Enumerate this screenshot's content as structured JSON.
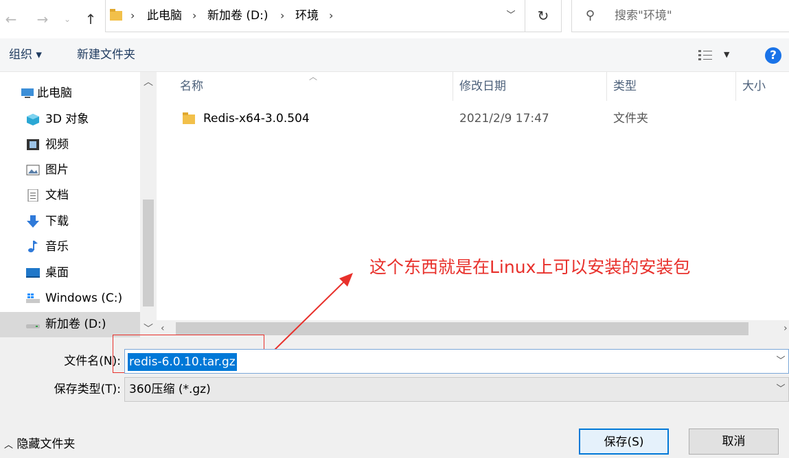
{
  "address_bar": {
    "breadcrumbs": [
      "此电脑",
      "新加卷 (D:)",
      "环境"
    ],
    "search_placeholder": "搜索\"环境\""
  },
  "toolbar": {
    "organize_label": "组织 ▾",
    "new_folder_label": "新建文件夹",
    "help_label": "?"
  },
  "nav_pane": {
    "items": [
      {
        "label": "此电脑",
        "icon": "computer-icon"
      },
      {
        "label": "3D 对象",
        "icon": "cube-3d-icon"
      },
      {
        "label": "视频",
        "icon": "video-icon"
      },
      {
        "label": "图片",
        "icon": "picture-icon"
      },
      {
        "label": "文档",
        "icon": "document-icon"
      },
      {
        "label": "下载",
        "icon": "download-icon"
      },
      {
        "label": "音乐",
        "icon": "music-icon"
      },
      {
        "label": "桌面",
        "icon": "desktop-icon"
      },
      {
        "label": "Windows (C:)",
        "icon": "windows-drive-icon"
      },
      {
        "label": "新加卷 (D:)",
        "icon": "drive-icon",
        "selected": true
      }
    ]
  },
  "file_list": {
    "columns": [
      "名称",
      "修改日期",
      "类型",
      "大小"
    ],
    "rows": [
      {
        "name": "Redis-x64-3.0.504",
        "modified": "2021/2/9 17:47",
        "type": "文件夹",
        "size": ""
      }
    ]
  },
  "annotation": {
    "text": "这个东西就是在Linux上可以安装的安装包",
    "color": "#e8302b"
  },
  "form": {
    "filename_label": "文件名(N):",
    "filename_value": "redis-6.0.10.tar.gz",
    "filetype_label": "保存类型(T):",
    "filetype_value": "360压缩 (*.gz)"
  },
  "footer": {
    "hide_folders_label": "隐藏文件夹",
    "save_label": "保存(S)",
    "cancel_label": "取消"
  },
  "colors": {
    "accent": "#0078d7",
    "folder": "#f2c04a",
    "help": "#1a73e8"
  }
}
